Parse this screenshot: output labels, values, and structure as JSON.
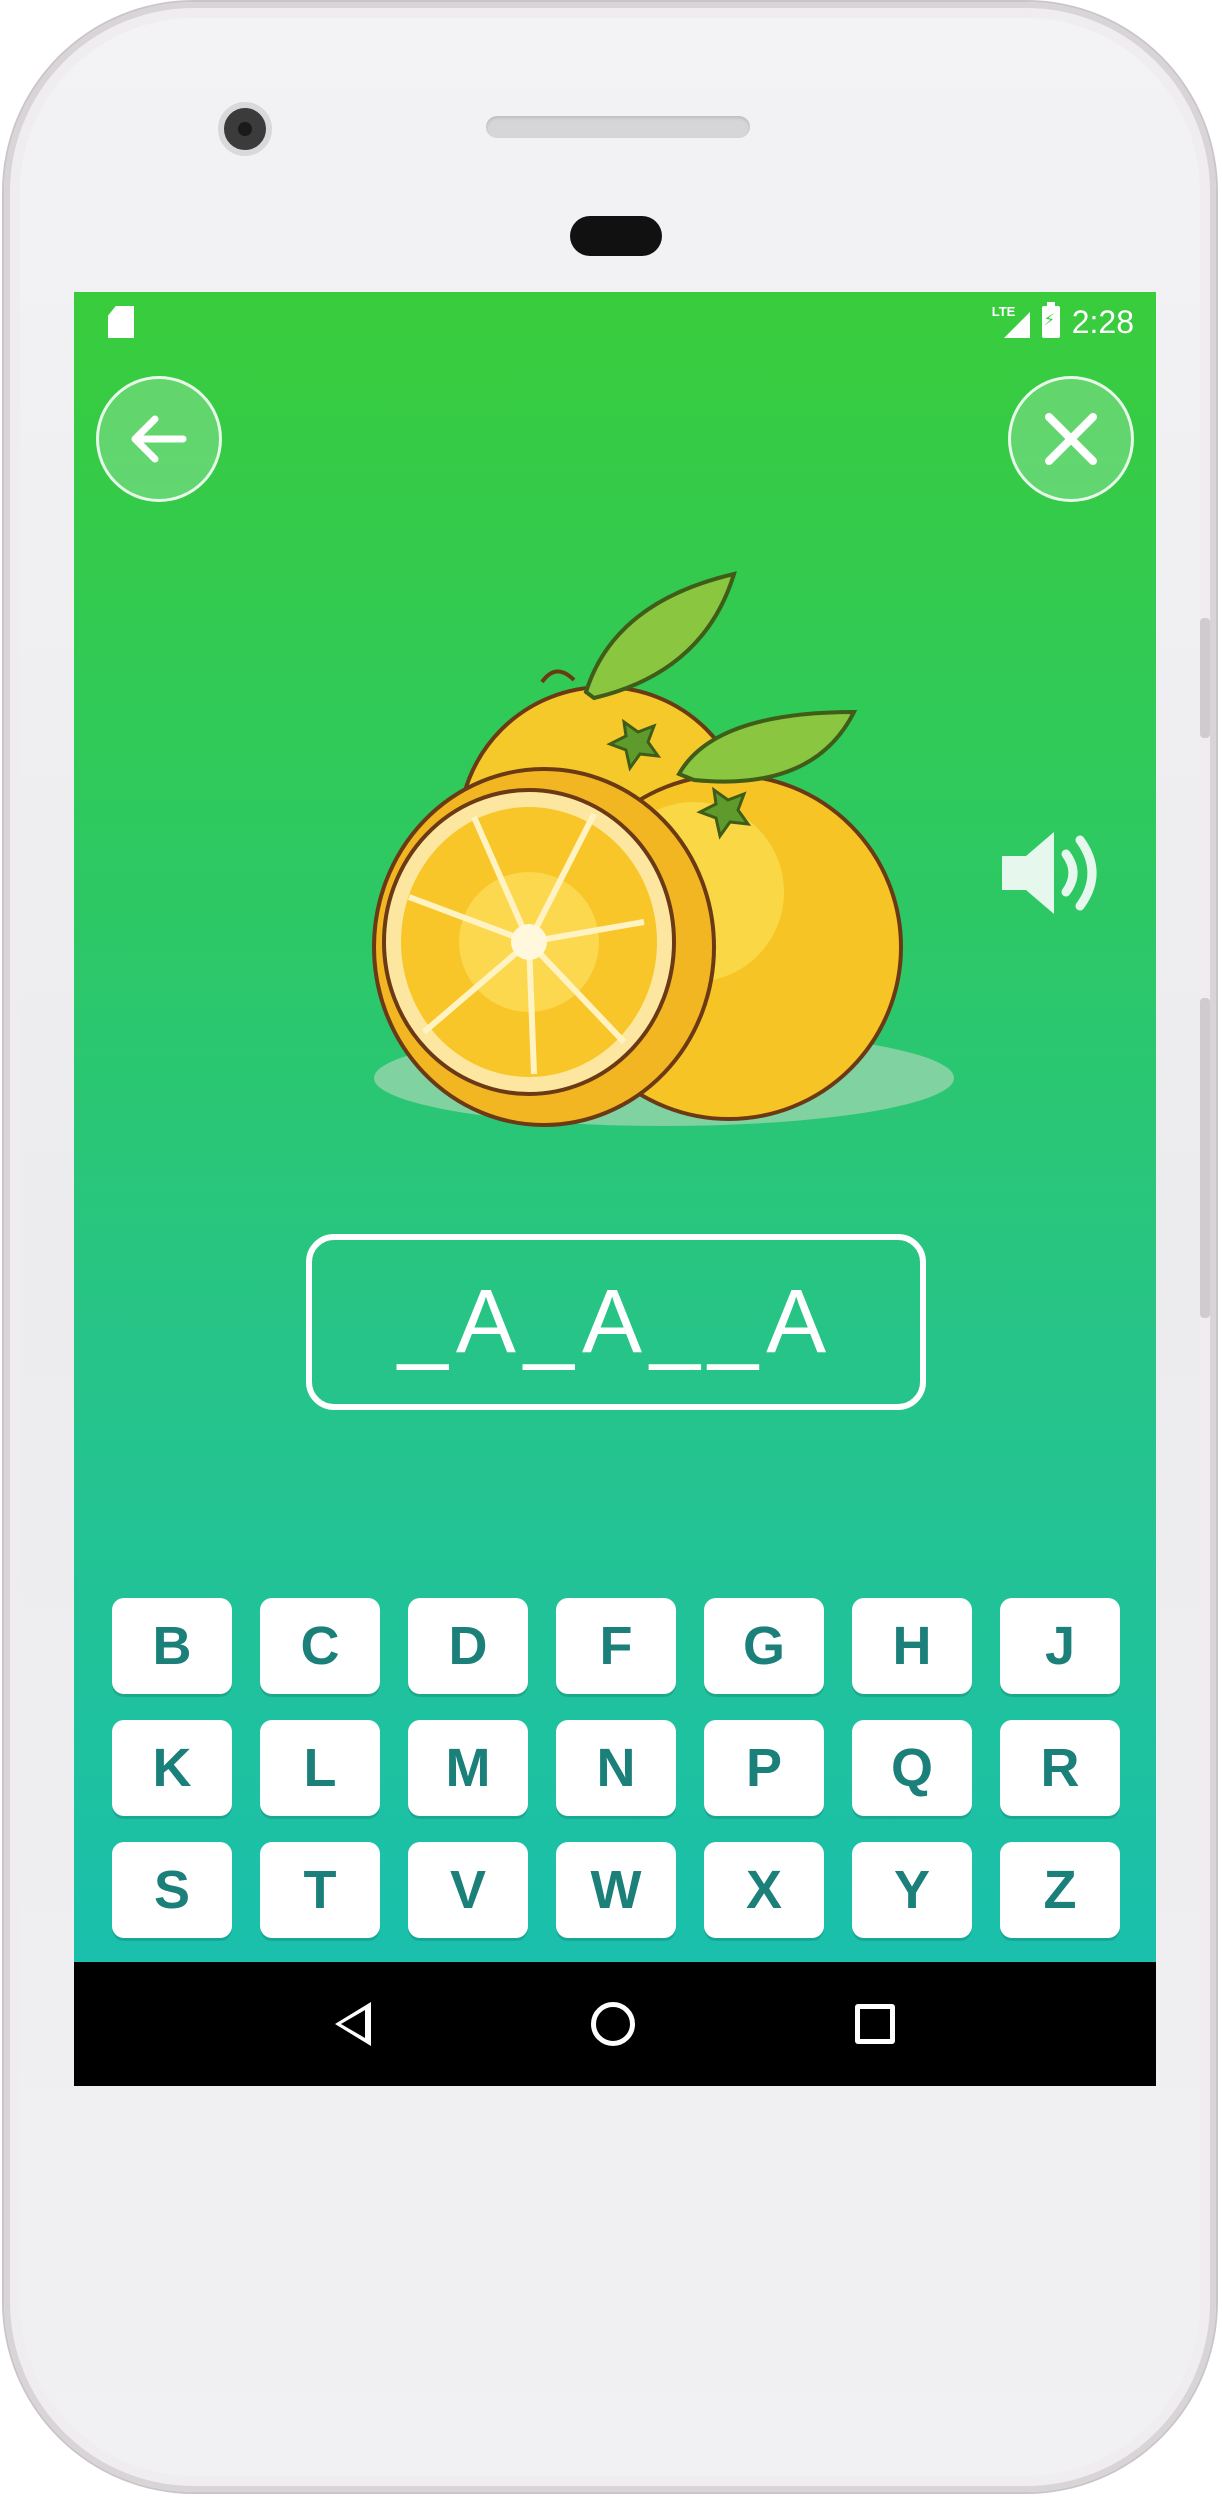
{
  "status_bar": {
    "time": "2:28",
    "network_label": "LTE"
  },
  "top_actions": {
    "back_icon": "arrow-left-icon",
    "close_icon": "close-icon"
  },
  "sound": {
    "icon": "speaker-icon"
  },
  "picture": {
    "icon": "orange-fruit-illustration"
  },
  "puzzle": {
    "word_display": "_A_A__A"
  },
  "keyboard": {
    "rows": [
      [
        "B",
        "C",
        "D",
        "F",
        "G",
        "H",
        "J"
      ],
      [
        "K",
        "L",
        "M",
        "N",
        "P",
        "Q",
        "R"
      ],
      [
        "S",
        "T",
        "V",
        "W",
        "X",
        "Y",
        "Z"
      ]
    ]
  },
  "colors": {
    "accent_top": "#39cc3c",
    "accent_bottom": "#17bfb3",
    "key_text": "#1b7f7a"
  }
}
